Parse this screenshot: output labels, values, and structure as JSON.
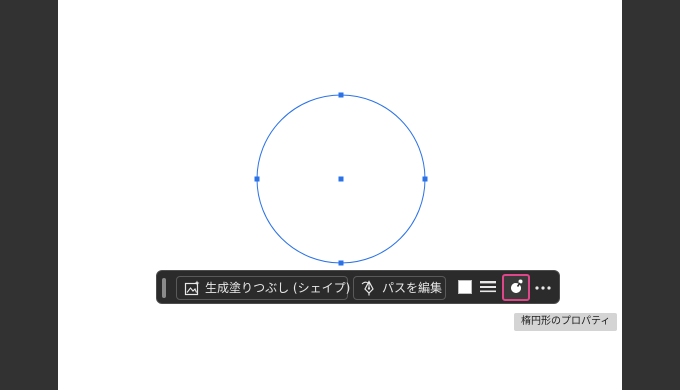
{
  "canvas": {
    "shape": "ellipse",
    "selection_color": "#2a72e8"
  },
  "taskbar": {
    "generative_fill_label": "生成塗りつぶし (シェイプ)",
    "edit_path_label": "パスを編集",
    "icons": {
      "generative_fill": "generative-fill-icon",
      "edit_path": "pen-path-icon",
      "fill": "fill-swatch",
      "stroke": "stroke-lines-icon",
      "properties": "ellipse-properties-icon",
      "more": "more-dots-icon"
    },
    "highlight_color": "#e0468a"
  },
  "tooltip": {
    "text": "楕円形のプロパティ"
  }
}
